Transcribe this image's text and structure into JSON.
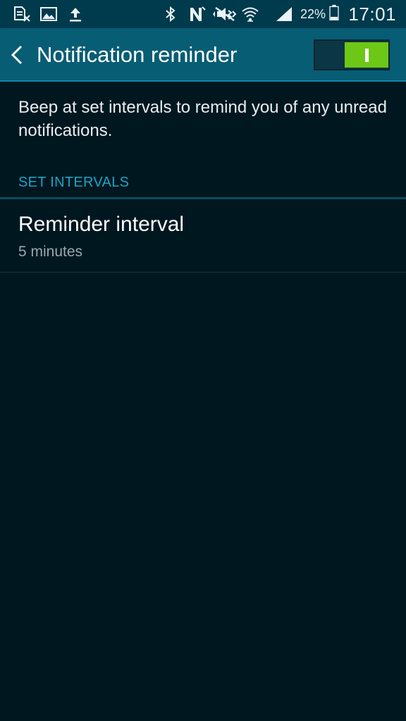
{
  "status_bar": {
    "icons": [
      "sim-card-x-icon",
      "image-icon",
      "upload-icon",
      "bluetooth-icon",
      "nfc-icon",
      "vibrate-mute-icon",
      "wifi-icon",
      "signal-icon",
      "battery-icon"
    ],
    "battery_percent": "22%",
    "battery_level": 0.22,
    "time": "17:01"
  },
  "action_bar": {
    "title": "Notification reminder",
    "switch_on": true,
    "accent_color": "#6dc716",
    "bar_color": "#075d74"
  },
  "description": "Beep at set intervals to remind you of any unread notifications.",
  "section": {
    "header": "SET INTERVALS",
    "header_color": "#1aa5c4"
  },
  "settings": [
    {
      "title": "Reminder interval",
      "value": "5 minutes"
    }
  ]
}
